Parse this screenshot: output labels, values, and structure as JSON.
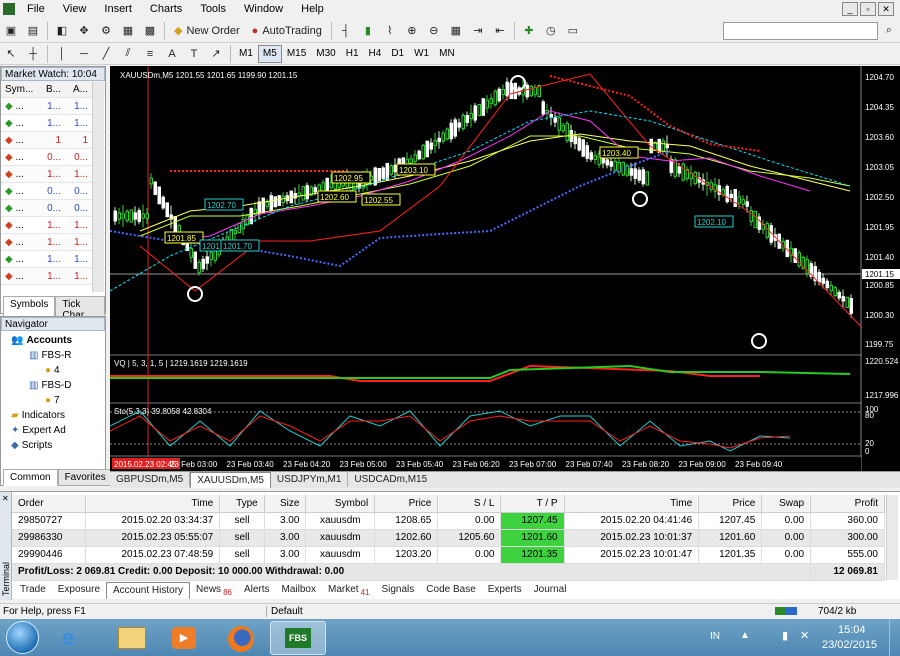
{
  "menu": [
    "File",
    "View",
    "Insert",
    "Charts",
    "Tools",
    "Window",
    "Help"
  ],
  "toolbar": {
    "new_order": "New Order",
    "autotrading": "AutoTrading",
    "timeframes": [
      "M1",
      "M5",
      "M15",
      "M30",
      "H1",
      "H4",
      "D1",
      "W1",
      "MN"
    ],
    "active_timeframe": "M5"
  },
  "market_watch": {
    "title": "Market Watch: 10:04",
    "columns": [
      "Sym...",
      "B...",
      "A..."
    ],
    "rows": [
      {
        "sym": "...",
        "bid": "1...",
        "ask": "1...",
        "dir": "up"
      },
      {
        "sym": "...",
        "bid": "1...",
        "ask": "1...",
        "dir": "up"
      },
      {
        "sym": "...",
        "bid": "1",
        "ask": "1",
        "dir": "down"
      },
      {
        "sym": "...",
        "bid": "0...",
        "ask": "0...",
        "dir": "down"
      },
      {
        "sym": "...",
        "bid": "1...",
        "ask": "1...",
        "dir": "down"
      },
      {
        "sym": "...",
        "bid": "0...",
        "ask": "0...",
        "dir": "up"
      },
      {
        "sym": "...",
        "bid": "0...",
        "ask": "0...",
        "dir": "up"
      },
      {
        "sym": "...",
        "bid": "1...",
        "ask": "1...",
        "dir": "down"
      },
      {
        "sym": "...",
        "bid": "1...",
        "ask": "1...",
        "dir": "down"
      },
      {
        "sym": "...",
        "bid": "1...",
        "ask": "1...",
        "dir": "up"
      },
      {
        "sym": "...",
        "bid": "1...",
        "ask": "1...",
        "dir": "down"
      }
    ],
    "tabs": [
      "Symbols",
      "Tick Char"
    ]
  },
  "navigator": {
    "title": "Navigator",
    "items": [
      "Accounts",
      "FBS-R",
      "4",
      "FBS-D",
      "7",
      "Indicators",
      "Expert Ad",
      "Scripts"
    ],
    "tabs": [
      "Common",
      "Favorites"
    ]
  },
  "chart": {
    "header": "XAUUSDm,M5  1201.55 1201.65 1199.90 1201.15",
    "price_labels": [
      "1204.70",
      "1204.35",
      "1203.60",
      "1203.05",
      "1202.50",
      "1201.95",
      "1201.40",
      "1201.15",
      "1200.85",
      "1200.30",
      "1199.75"
    ],
    "current_price": "1201.15",
    "box_labels": [
      "1203.40",
      "1203.10",
      "1202.95",
      "1202.60",
      "1202.55",
      "1201.85",
      "1201.70",
      "1202.70",
      "1201.70",
      "1202.10"
    ],
    "vq_label": "VQ | 5, 3, 1, 5 | 1219.1619 1219.1619",
    "vq_levels": [
      "1220.524",
      "1217.996"
    ],
    "sto_label": "Sto(5,3,3) 39.8058 42.8304",
    "sto_levels": [
      "100",
      "80",
      "20",
      "0"
    ],
    "time_labels": [
      "2015.02.23 02:45",
      "23 Feb 03:00",
      "23 Feb 03:40",
      "23 Feb 04:20",
      "23 Feb 05:00",
      "23 Feb 05:40",
      "23 Feb 06:20",
      "23 Feb 07:00",
      "23 Feb 07:40",
      "23 Feb 08:20",
      "23 Feb 09:00",
      "23 Feb 09:40"
    ],
    "tabs": [
      "GBPUSDm,M5",
      "XAUUSDm,M5",
      "USDJPYm,M1",
      "USDCADm,M15"
    ],
    "active_tab": "XAUUSDm,M5"
  },
  "terminal": {
    "side_label": "Terminal",
    "columns": [
      "Order",
      "Time",
      "Type",
      "Size",
      "Symbol",
      "Price",
      "S / L",
      "T / P",
      "Time",
      "Price",
      "Swap",
      "Profit"
    ],
    "rows": [
      [
        "29850727",
        "2015.02.20 03:34:37",
        "sell",
        "3.00",
        "xauusdm",
        "1208.65",
        "0.00",
        "1207.45",
        "2015.02.20 04:41:46",
        "1207.45",
        "0.00",
        "360.00"
      ],
      [
        "29986330",
        "2015.02.23 05:55:07",
        "sell",
        "3.00",
        "xauusdm",
        "1202.60",
        "1205.60",
        "1201.60",
        "2015.02.23 10:01:37",
        "1201.60",
        "0.00",
        "300.00"
      ],
      [
        "29990446",
        "2015.02.23 07:48:59",
        "sell",
        "3.00",
        "xauusdm",
        "1203.20",
        "0.00",
        "1201.35",
        "2015.02.23 10:01:47",
        "1201.35",
        "0.00",
        "555.00"
      ]
    ],
    "summary": "Profit/Loss: 2 069.81  Credit: 0.00  Deposit: 10 000.00  Withdrawal: 0.00",
    "summary_total": "12 069.81",
    "tabs": [
      "Trade",
      "Exposure",
      "Account History",
      "News",
      "Alerts",
      "Mailbox",
      "Market",
      "Signals",
      "Code Base",
      "Experts",
      "Journal"
    ],
    "news_count": "86",
    "market_count": "41",
    "active_tab": "Account History"
  },
  "status": {
    "help": "For Help, press F1",
    "profile": "Default",
    "traffic": "704/2 kb"
  },
  "taskbar": {
    "lang": "IN",
    "time": "15:04",
    "date": "23/02/2015",
    "fbs": "FBS"
  },
  "colors": {
    "tp_green": "#3fd23f",
    "chart_bg": "#000000",
    "up_candle": "#33cc33"
  }
}
